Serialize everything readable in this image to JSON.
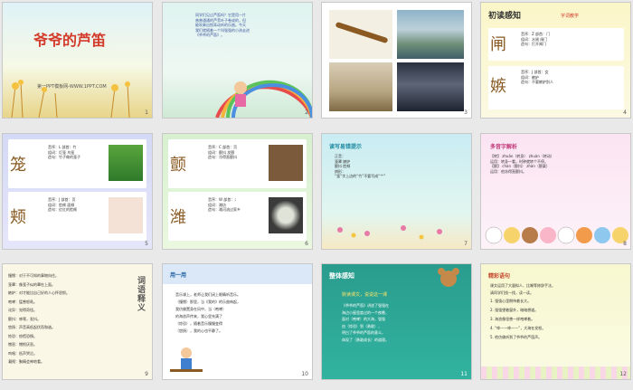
{
  "slides": [
    {
      "num": "1",
      "title": "爷爷的芦笛",
      "subtitle": "第一PPT模板网-WWW.1PPT.COM"
    },
    {
      "num": "2",
      "lines": [
        "同学们见过芦笛吗？它是用一片",
        "普普通通的芦苇叶子卷成的，但",
        "能吹奏出悦耳动听的乐曲。今天",
        "我们就随着一个叫强强的小孩走进",
        "《爷爷的芦笛》。"
      ]
    },
    {
      "num": "3"
    },
    {
      "num": "4",
      "title": "初读感知",
      "label": "字词教学",
      "chars": [
        "闸",
        "嫉"
      ],
      "lines": [
        "音序：Z 部首：门",
        "组词：水闸 闸门",
        "造句：打开闸门",
        "音序：J 部首：女",
        "组词：嫉妒",
        "造句：不要嫉妒别人"
      ]
    },
    {
      "num": "5",
      "chars": [
        "笼",
        "颊"
      ],
      "lines": [
        "音序：L 部首：竹",
        "组词：灯笼 鸟笼",
        "造句：竹子做的笼子",
        "音序：J 部首：页",
        "组词：脸颊 面颊",
        "造句：红红的脸颊"
      ]
    },
    {
      "num": "6",
      "chars": [
        "颤",
        "潍"
      ],
      "lines": [
        "音序：C 部首：页",
        "组词：颤抖 发颤",
        "造句：冷得直颤抖",
        "音序：W 部首：氵",
        "组词：潍坊",
        "造句：潍河流过家乡"
      ]
    },
    {
      "num": "7",
      "title": "读写易错提示",
      "lines": [
        "正音：",
        "笼罩 嫉妒",
        "颤抖 脸颊",
        "辨形：",
        "“笼”字上边的“竹”不要写成“艹”"
      ]
    },
    {
      "num": "8",
      "title": "多音字解析",
      "lines": [
        "【转】 zhuǎn（转身） zhuàn（转动）",
        "运用：转身一看，时钟就转个不停。",
        "【颤】 chàn（颤抖） zhàn（颤栗）",
        "运用：他冻得直颤抖。"
      ]
    },
    {
      "num": "9",
      "side_title": "词语释义",
      "lines": [
        "憧憬：对于不可知的事物向往。",
        "笼罩：像笼子似的罩在上面。",
        "嫉妒：对才能比自己好的人心怀怨恨。",
        "咆哮：猛兽怒吼。",
        "诧异：觉得奇怪。",
        "颤抖：哆嗦，发抖。",
        "悠扬：声音高低起伏而和谐。",
        "惊恐：惊慌恐惧。",
        "憎恶：憎恨厌恶。",
        "呜咽：低声哭泣。",
        "凝视：聚精会神地看。"
      ]
    },
    {
      "num": "10",
      "title": "用一用",
      "lines": [
        "音乐课上，老师让我们闭上眼睛听音乐。",
        "（憧憬）那里，当《我的》的乐曲响起，",
        "我仿佛置身在风中，当（咆哮）",
        "的海浪声传来，我心里充满了",
        "（惊恐），随着音乐慢慢变得",
        "（悠扬），我的心也平静了。"
      ]
    },
    {
      "num": "11",
      "title": "整体感知",
      "subtitle": "默读课文，说说这一课",
      "lines": [
        "《爷爷的芦笛》讲述了强强在",
        "海边小屋里度过的一个夜晚，",
        "面对（咆哮）的大海，强强",
        "由（惊恐）到（勇敢），",
        "明白了爷爷的芦笛的意义，",
        "体现了（勇敢成长）的道理。"
      ]
    },
    {
      "num": "12",
      "title": "精彩语句",
      "lines": [
        "课文运用了大量拟人、比喻等修辞手法，",
        "请同学们找一找，读一读。",
        "1. 强强心里期待着长大。",
        "2. 强强望着窗外，暗暗想道。",
        "3. 海浪像怪兽一样咆哮着。",
        "4. “哗——哗——”，大海在发怒。",
        "5. 他仿佛听到了爷爷的芦笛声。"
      ]
    }
  ]
}
